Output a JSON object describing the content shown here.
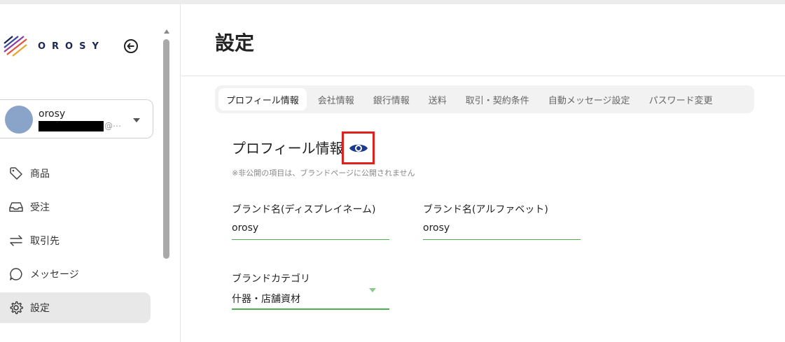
{
  "brand": {
    "logo_text": "OROSY"
  },
  "account": {
    "name": "orosy",
    "email_suffix": "@⋯"
  },
  "sidebar": {
    "items": [
      {
        "label": "商品",
        "icon": "tag-icon"
      },
      {
        "label": "受注",
        "icon": "inbox-icon"
      },
      {
        "label": "取引先",
        "icon": "swap-icon"
      },
      {
        "label": "メッセージ",
        "icon": "chat-icon"
      },
      {
        "label": "設定",
        "icon": "gear-icon",
        "active": true
      }
    ]
  },
  "page": {
    "title": "設定"
  },
  "tabs": [
    {
      "label": "プロフィール情報",
      "active": true
    },
    {
      "label": "会社情報"
    },
    {
      "label": "銀行情報"
    },
    {
      "label": "送料"
    },
    {
      "label": "取引・契約条件"
    },
    {
      "label": "自動メッセージ設定"
    },
    {
      "label": "パスワード変更"
    }
  ],
  "profile": {
    "section_title": "プロフィール情報",
    "note": "※非公開の項目は、ブランドページに公開されません",
    "brand_name_display_label": "ブランド名(ディスプレイネーム)",
    "brand_name_display_value": "orosy",
    "brand_name_alpha_label": "ブランド名(アルファベット)",
    "brand_name_alpha_value": "orosy",
    "brand_category_label": "ブランドカテゴリ",
    "brand_category_value": "什器・店舗資材"
  },
  "colors": {
    "accent_green": "#4caf50",
    "highlight_red": "#e0211d",
    "eye_blue": "#1a3a8a"
  }
}
